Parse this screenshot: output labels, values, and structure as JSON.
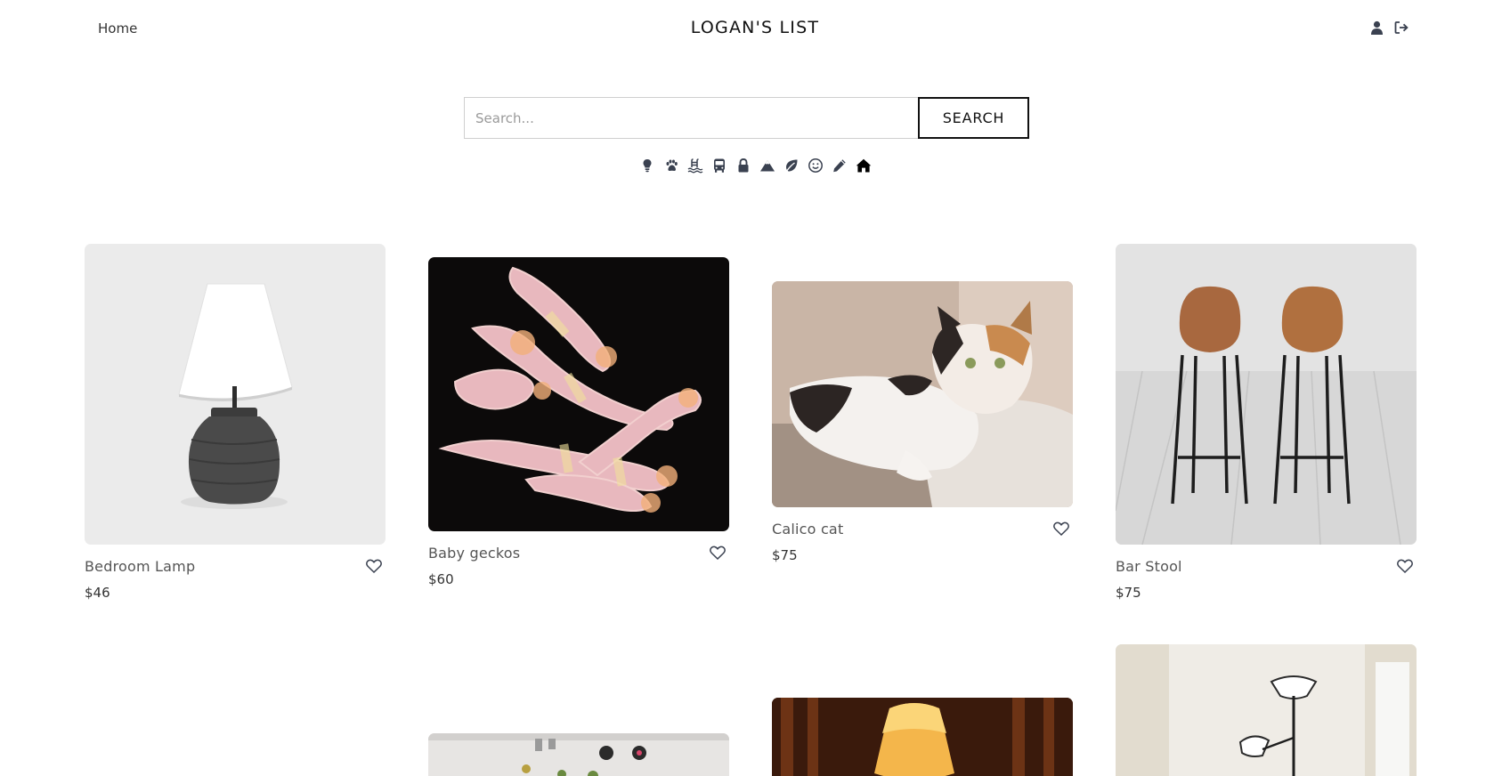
{
  "nav": {
    "home_label": "Home",
    "brand": "LOGAN'S LIST",
    "actions": [
      "user-icon",
      "logout-icon"
    ]
  },
  "search": {
    "placeholder": "Search...",
    "value": "",
    "button_label": "SEARCH"
  },
  "categories": [
    {
      "icon": "lightbulb-icon"
    },
    {
      "icon": "paw-icon"
    },
    {
      "icon": "swimming-icon"
    },
    {
      "icon": "bus-icon"
    },
    {
      "icon": "lock-icon"
    },
    {
      "icon": "mountain-icon"
    },
    {
      "icon": "leaf-icon"
    },
    {
      "icon": "smile-icon"
    },
    {
      "icon": "pencil-icon"
    },
    {
      "icon": "home-icon"
    }
  ],
  "listings": [
    {
      "title": "Bedroom Lamp",
      "price": "$46"
    },
    {
      "title": "Baby geckos",
      "price": "$60"
    },
    {
      "title": "Calico cat",
      "price": "$75"
    },
    {
      "title": "Bar Stool",
      "price": "$75"
    }
  ],
  "colors": {
    "text": "#222222",
    "muted": "#555555",
    "border": "#cfcfcf",
    "icon": "#3a4150"
  }
}
